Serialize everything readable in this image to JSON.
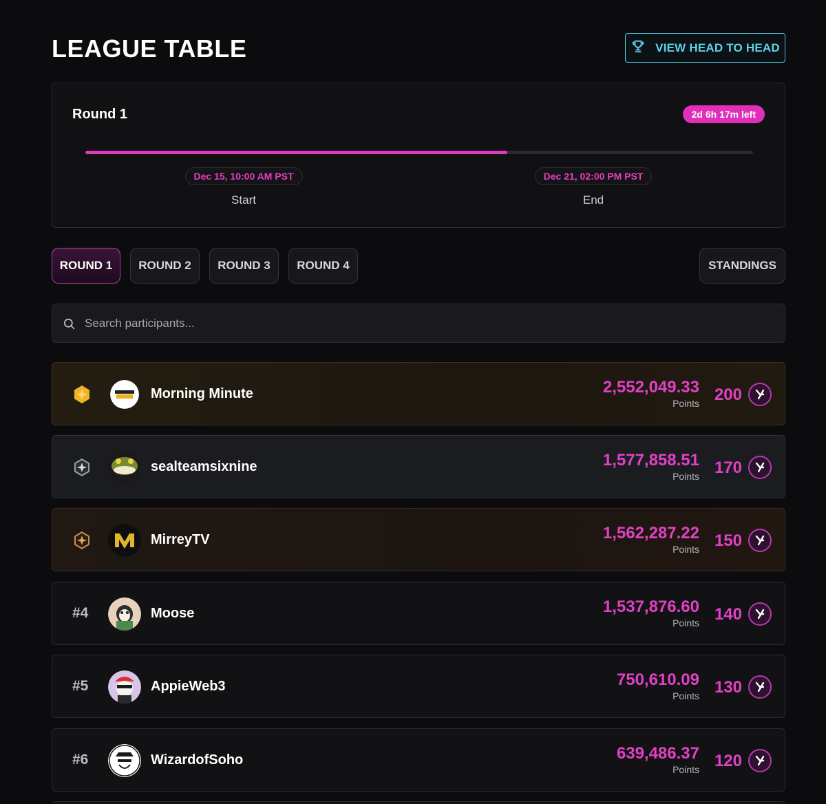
{
  "header": {
    "title": "LEAGUE TABLE",
    "h2h_label": "VIEW HEAD TO HEAD"
  },
  "round_card": {
    "title": "Round 1",
    "time_left": "2d 6h 17m left",
    "progress": 0.632,
    "start": {
      "date": "Dec 15, 10:00 AM PST",
      "label": "Start"
    },
    "end": {
      "date": "Dec 21, 02:00 PM PST",
      "label": "End"
    }
  },
  "tabs": [
    {
      "label": "ROUND 1",
      "active": true
    },
    {
      "label": "ROUND 2",
      "active": false
    },
    {
      "label": "ROUND 3",
      "active": false
    },
    {
      "label": "ROUND 4",
      "active": false
    }
  ],
  "standings_label": "STANDINGS",
  "search": {
    "placeholder": "Search participants..."
  },
  "points_unit": "Points",
  "rows": [
    {
      "rank": "1",
      "medal": "gold",
      "name": "Morning Minute",
      "points": "2,552,049.33",
      "reward": "200"
    },
    {
      "rank": "2",
      "medal": "silver",
      "name": "sealteamsixnine",
      "points": "1,577,858.51",
      "reward": "170"
    },
    {
      "rank": "3",
      "medal": "bronze",
      "name": "MirreyTV",
      "points": "1,562,287.22",
      "reward": "150"
    },
    {
      "rank": "#4",
      "medal": "",
      "name": "Moose",
      "points": "1,537,876.60",
      "reward": "140"
    },
    {
      "rank": "#5",
      "medal": "",
      "name": "AppieWeb3",
      "points": "750,610.09",
      "reward": "130"
    },
    {
      "rank": "#6",
      "medal": "",
      "name": "WizardofSoho",
      "points": "639,486.37",
      "reward": "120"
    }
  ],
  "colors": {
    "accent": "#e041c4",
    "cyan": "#5fd3eb",
    "gold": "#f2b22a",
    "silver": "#9a9ca4",
    "bronze": "#c98a4e"
  }
}
